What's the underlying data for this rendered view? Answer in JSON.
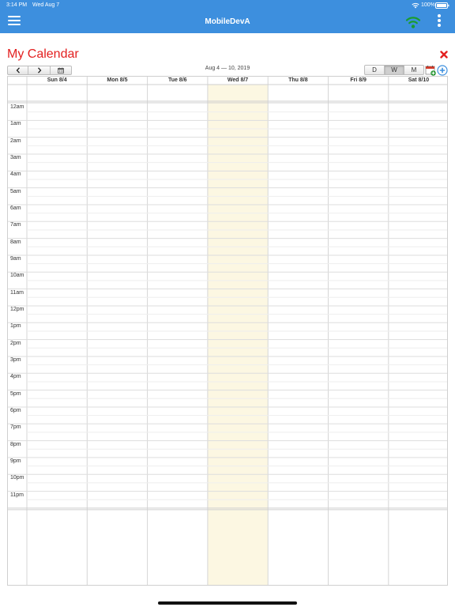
{
  "status_bar": {
    "time": "3:14 PM",
    "date": "Wed Aug 7",
    "battery": "100%",
    "wifi_icon": "wifi-icon",
    "battery_icon": "battery-icon"
  },
  "app_bar": {
    "title": "MobileDevA",
    "menu_icon": "hamburger-menu-icon",
    "connection_icon": "wifi-signal-icon",
    "more_icon": "more-vertical-icon",
    "background_color": "#3d8fde",
    "connection_color": "#1a9c2e"
  },
  "page": {
    "title": "My Calendar",
    "title_color": "#e32020",
    "close_icon": "close-icon",
    "close_color": "#e32020"
  },
  "toolbar": {
    "prev_icon": "chevron-left-icon",
    "next_icon": "chevron-right-icon",
    "date_picker_icon": "calendar-icon",
    "date_range": "Aug 4 — 10, 2019",
    "views": [
      "D",
      "W",
      "M"
    ],
    "selected_view": "W",
    "add_calendar_icon": "add-calendar-icon",
    "add_event_icon": "add-circle-icon"
  },
  "calendar": {
    "days": [
      "Sun 8/4",
      "Mon 8/5",
      "Tue 8/6",
      "Wed 8/7",
      "Thu 8/8",
      "Fri 8/9",
      "Sat 8/10"
    ],
    "today": "Wed 8/7",
    "today_color": "#fcf7e2",
    "hours": [
      "12am",
      "1am",
      "2am",
      "3am",
      "4am",
      "5am",
      "6am",
      "7am",
      "8am",
      "9am",
      "10am",
      "11am",
      "12pm",
      "1pm",
      "2pm",
      "3pm",
      "4pm",
      "5pm",
      "6pm",
      "7pm",
      "8pm",
      "9pm",
      "10pm",
      "11pm"
    ]
  }
}
